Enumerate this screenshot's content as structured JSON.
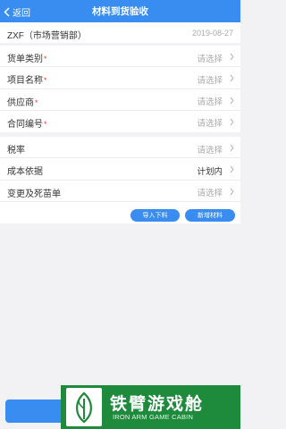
{
  "nav": {
    "back_label": "返回",
    "title": "材料到货验收"
  },
  "header": {
    "org": "ZXF（市场营销部）",
    "date": "2019-08-27"
  },
  "form_group_1": [
    {
      "label": "货单类别",
      "required_mark": "*",
      "value": "请选择"
    },
    {
      "label": "项目名称",
      "required_mark": "*",
      "value": "请选择"
    },
    {
      "label": "供应商",
      "required_mark": "*",
      "value": "请选择"
    },
    {
      "label": "合同编号",
      "required_mark": "*",
      "value": "请选择"
    }
  ],
  "form_group_2": [
    {
      "label": "税率",
      "value": "请选择"
    },
    {
      "label": "成本依据",
      "value": "计划内"
    },
    {
      "label": "变更及死苗单",
      "value": "请选择"
    }
  ],
  "actions": {
    "import_label": "导入下料",
    "add_label": "新增材料"
  },
  "watermark": {
    "title": "铁臂游戏舱",
    "subtitle": "IRON ARM GAME CABIN"
  },
  "colors": {
    "accent": "#3a8df0",
    "required": "#e84545",
    "watermark_bg": "#1e8a3c"
  }
}
